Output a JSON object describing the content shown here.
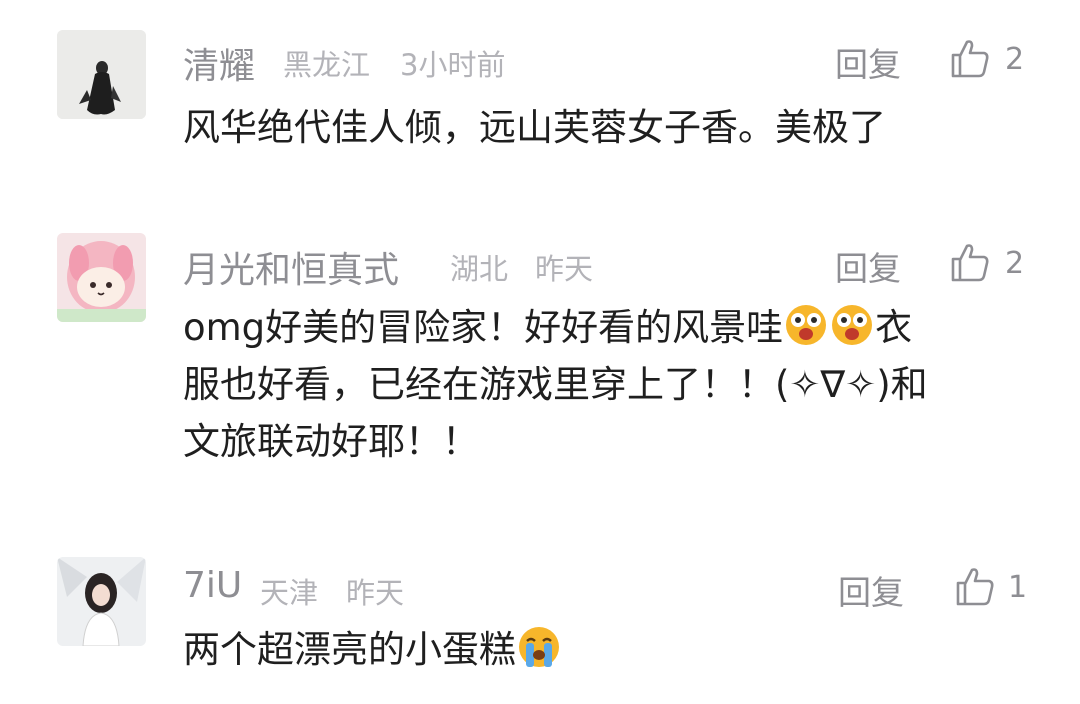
{
  "comments": [
    {
      "username": "清耀",
      "location": "黑龙江",
      "time": "3小时前",
      "reply_label": "回复",
      "like_count": "2",
      "lines": [
        "风华绝代佳人倾，远山芙蓉女子香。美极了"
      ]
    },
    {
      "username": "月光和恒真式",
      "location": "湖北",
      "time": "昨天",
      "reply_label": "回复",
      "like_count": "2",
      "line1_text": "omg好美的冒险家！好好看的风景哇",
      "line1_tail": "衣",
      "line2": "服也好看，已经在游戏里穿上了！！(✧∇✧)和",
      "line3": "文旅联动好耶！！"
    },
    {
      "username": "7iU",
      "location": "天津",
      "time": "昨天",
      "reply_label": "回复",
      "like_count": "1",
      "line1_text": "两个超漂亮的小蛋糕"
    }
  ],
  "icons": {
    "like": "thumbs-up-icon",
    "emoji_star_eyes": "star-struck-emoji",
    "emoji_crying": "loudly-crying-emoji"
  },
  "colors": {
    "meta_text": "#8e8e93",
    "location_text": "#b3b3b8",
    "body_text": "#1f1f1f"
  }
}
